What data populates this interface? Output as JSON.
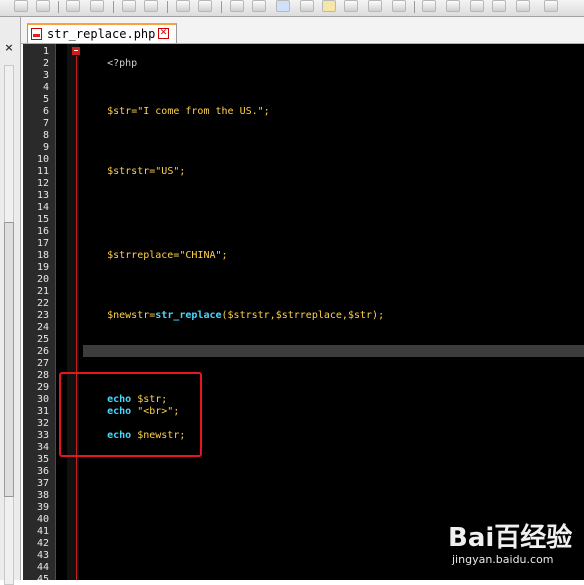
{
  "tab": {
    "filename": "str_replace.php",
    "close_glyph": "✕"
  },
  "left_panel": {
    "close_glyph": "×"
  },
  "editor": {
    "line_numbers": [
      "1",
      "2",
      "3",
      "4",
      "5",
      "6",
      "7",
      "8",
      "9",
      "10",
      "11",
      "12",
      "13",
      "14",
      "15",
      "16",
      "17",
      "18",
      "19",
      "20",
      "21",
      "22",
      "23",
      "24",
      "25",
      "26",
      "27",
      "28",
      "29",
      "30",
      "31",
      "32",
      "33",
      "34",
      "35",
      "36",
      "37",
      "38",
      "39",
      "40",
      "41",
      "42",
      "43",
      "44",
      "45"
    ],
    "lines": {
      "l1": "<?php",
      "l5": {
        "var": "$str",
        "eq": "=",
        "val": "\"I come from the US.\"",
        "end": ";"
      },
      "l10": {
        "var": "$strstr",
        "eq": "=",
        "val": "\"US\"",
        "end": ";"
      },
      "l17": {
        "var": "$strreplace",
        "eq": "=",
        "val": "\"CHINA\"",
        "end": ";"
      },
      "l22": {
        "var": "$newstr",
        "eq": "=",
        "fn": "str_replace",
        "args": "($strstr,$strreplace,$str)",
        "end": ";"
      },
      "l29": {
        "kw": "echo",
        "rest": " $str;"
      },
      "l30": {
        "kw": "echo",
        "rest": " \"<br>\";"
      },
      "l32": {
        "kw": "echo",
        "rest": " $newstr;"
      }
    },
    "current_line": "26"
  },
  "colors": {
    "background": "#000000",
    "variable": "#ffd24a",
    "keyword": "#46d8ff",
    "annotation": "#e8141e"
  },
  "watermark": {
    "logo": "Bai百经验",
    "url": "jingyan.baidu.com"
  }
}
